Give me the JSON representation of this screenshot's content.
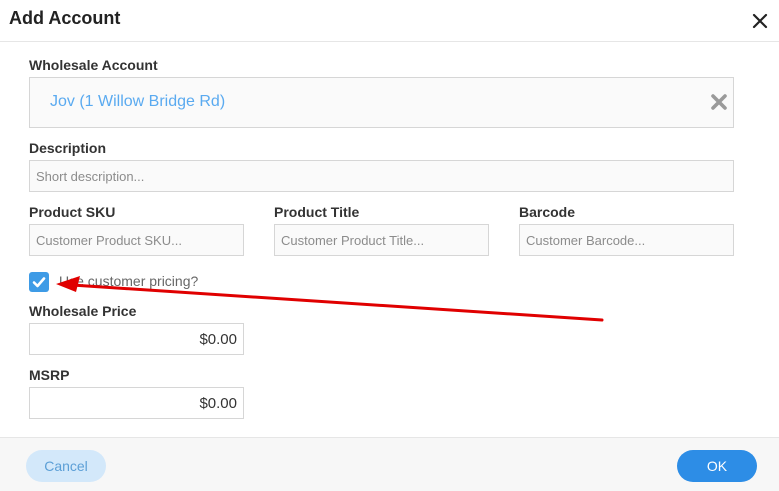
{
  "dialog": {
    "title": "Add Account"
  },
  "wholesale_account": {
    "label": "Wholesale Account",
    "value": "Jov (1 Willow Bridge Rd)"
  },
  "description": {
    "label": "Description",
    "placeholder": "Short description...",
    "value": ""
  },
  "product_sku": {
    "label": "Product SKU",
    "placeholder": "Customer Product SKU...",
    "value": ""
  },
  "product_title": {
    "label": "Product Title",
    "placeholder": "Customer Product Title...",
    "value": ""
  },
  "barcode": {
    "label": "Barcode",
    "placeholder": "Customer Barcode...",
    "value": ""
  },
  "customer_pricing": {
    "label": "Use customer pricing?",
    "checked": true
  },
  "wholesale_price": {
    "label": "Wholesale Price",
    "value": "$0.00"
  },
  "msrp": {
    "label": "MSRP",
    "value": "$0.00"
  },
  "footer": {
    "cancel_label": "Cancel",
    "ok_label": "OK"
  },
  "icons": {
    "close": "close-icon",
    "clear": "clear-icon",
    "check": "check-icon"
  },
  "colors": {
    "accent": "#2d8de6",
    "checkbox": "#3e9be6",
    "account_text": "#5aaaf0",
    "cancel_bg": "#d3e8fa",
    "annotation_arrow": "#e00000"
  }
}
